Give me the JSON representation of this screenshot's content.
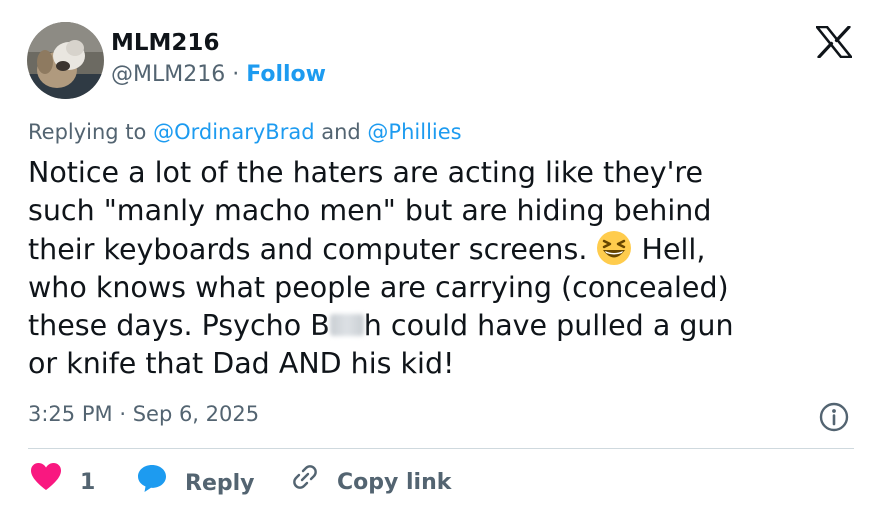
{
  "author": {
    "display_name": "MLM216",
    "handle": "@MLM216",
    "separator": "·",
    "follow_label": "Follow"
  },
  "reply_context": {
    "prefix": "Replying to",
    "mention_1": "@OrdinaryBrad",
    "conjunction": "and",
    "mention_2": "@Phillies"
  },
  "tweet": {
    "line_1": "Notice a lot of the haters are acting like they're",
    "line_2": "such \"manly macho men\" but are hiding behind",
    "line_3_before_emoji": "their keyboards and computer screens.",
    "line_3_after_emoji": "Hell,",
    "line_4": "who knows what people are carrying (concealed)",
    "line_5_before_censor": "these days. Psycho B",
    "line_5_after_censor": "h could have pulled a gun",
    "line_6": "or knife that Dad AND his kid!",
    "emoji": "grinning-squinting-face-emoji"
  },
  "timestamp": {
    "time": "3:25 PM",
    "separator": "·",
    "date": "Sep 6, 2025"
  },
  "actions": {
    "like_count": "1",
    "reply_label": "Reply",
    "copy_link_label": "Copy link"
  },
  "icons": {
    "platform": "x-logo-icon",
    "info": "info-icon",
    "like": "heart-icon",
    "reply": "speech-bubble-icon",
    "copy": "link-icon"
  },
  "colors": {
    "accent": "#1d9bf0",
    "text_primary": "#0f1419",
    "text_secondary": "#536471",
    "like": "#f91880",
    "divider": "#cfd9de"
  }
}
